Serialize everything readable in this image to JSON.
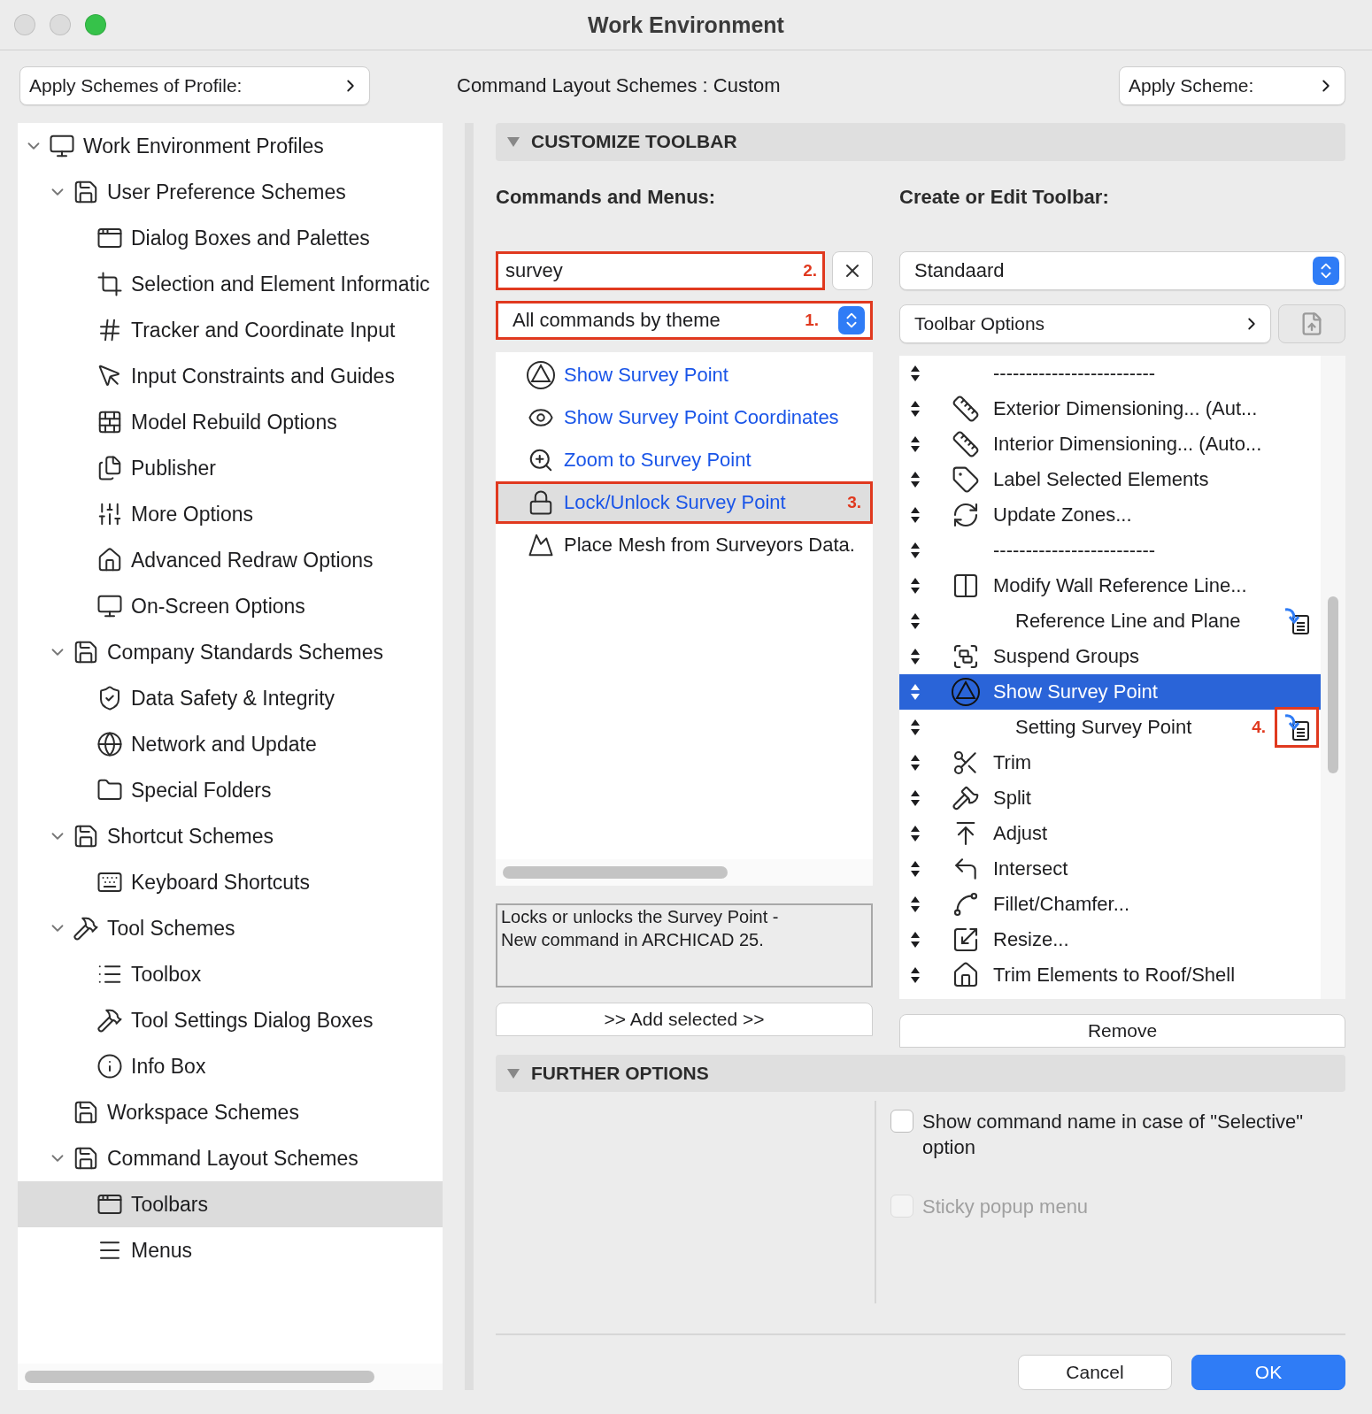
{
  "window": {
    "title": "Work Environment"
  },
  "top_bar": {
    "profile_button": "Apply Schemes of Profile:",
    "scheme_label": "Command Layout Schemes :",
    "scheme_value": "Custom",
    "apply_button": "Apply Scheme:"
  },
  "sidebar": {
    "items": [
      {
        "label": "Work Environment Profiles",
        "expanded": true,
        "selected": false,
        "children": [
          {
            "label": "User Preference Schemes",
            "expanded": true,
            "selected": false,
            "children": [
              {
                "label": "Dialog Boxes and Palettes",
                "selected": false
              },
              {
                "label": "Selection and Element Informatic",
                "selected": false
              },
              {
                "label": "Tracker and Coordinate Input",
                "selected": false
              },
              {
                "label": "Input Constraints and Guides",
                "selected": false
              },
              {
                "label": "Model Rebuild Options",
                "selected": false
              },
              {
                "label": "Publisher",
                "selected": false
              },
              {
                "label": "More Options",
                "selected": false
              },
              {
                "label": "Advanced Redraw Options",
                "selected": false
              },
              {
                "label": "On-Screen Options",
                "selected": false
              }
            ]
          },
          {
            "label": "Company Standards Schemes",
            "expanded": true,
            "selected": false,
            "children": [
              {
                "label": "Data Safety & Integrity",
                "selected": false
              },
              {
                "label": "Network and Update",
                "selected": false
              },
              {
                "label": "Special Folders",
                "selected": false
              }
            ]
          },
          {
            "label": "Shortcut Schemes",
            "expanded": true,
            "selected": false,
            "children": [
              {
                "label": "Keyboard Shortcuts",
                "selected": false
              }
            ]
          },
          {
            "label": "Tool Schemes",
            "expanded": true,
            "selected": false,
            "children": [
              {
                "label": "Toolbox",
                "selected": false
              },
              {
                "label": "Tool Settings Dialog Boxes",
                "selected": false
              },
              {
                "label": "Info Box",
                "selected": false
              }
            ]
          },
          {
            "label": "Workspace Schemes",
            "selected": false
          },
          {
            "label": "Command Layout Schemes",
            "expanded": true,
            "selected": false,
            "children": [
              {
                "label": "Toolbars",
                "selected": true
              },
              {
                "label": "Menus",
                "selected": false
              }
            ]
          }
        ]
      }
    ]
  },
  "customize": {
    "title": "CUSTOMIZE TOOLBAR",
    "expanded": true
  },
  "commands": {
    "heading": "Commands and Menus:",
    "search": {
      "value": "survey",
      "annotation": "2."
    },
    "filter": {
      "value": "All commands by theme",
      "annotation": "1."
    },
    "items": [
      {
        "label": "Show Survey Point",
        "highlighted": true,
        "selected": false
      },
      {
        "label": "Show Survey Point Coordinates",
        "highlighted": true,
        "selected": false
      },
      {
        "label": "Zoom to Survey Point",
        "highlighted": true,
        "selected": false
      },
      {
        "label": "Lock/Unlock Survey Point",
        "highlighted": true,
        "selected": true,
        "annotation": "3."
      },
      {
        "label": "Place Mesh from Surveyors Data.",
        "highlighted": false,
        "selected": false
      }
    ],
    "description": "Locks or unlocks the Survey Point -\nNew command in ARCHICAD 25.",
    "add_button": ">> Add selected >>"
  },
  "toolbar": {
    "heading": "Create or Edit Toolbar:",
    "select": "Standaard",
    "options_button": "Toolbar Options",
    "items": [
      {
        "kind": "separator",
        "label": "-------------------------",
        "selected": false
      },
      {
        "kind": "command",
        "label": "Exterior Dimensioning... (Aut...",
        "selected": false
      },
      {
        "kind": "command",
        "label": "Interior Dimensioning... (Auto...",
        "selected": false
      },
      {
        "kind": "command",
        "label": "Label Selected Elements",
        "selected": false
      },
      {
        "kind": "command",
        "label": "Update Zones...",
        "selected": false
      },
      {
        "kind": "separator",
        "label": "-------------------------",
        "selected": false
      },
      {
        "kind": "command",
        "label": "Modify Wall Reference Line...",
        "selected": false
      },
      {
        "kind": "sub",
        "label": "Reference Line and Plane",
        "selected": false
      },
      {
        "kind": "command",
        "label": "Suspend Groups",
        "selected": false
      },
      {
        "kind": "command",
        "label": "Show Survey Point",
        "selected": true
      },
      {
        "kind": "sub",
        "label": "Setting Survey Point",
        "selected": false,
        "annotation": "4."
      },
      {
        "kind": "command",
        "label": "Trim",
        "selected": false
      },
      {
        "kind": "command",
        "label": "Split",
        "selected": false
      },
      {
        "kind": "command",
        "label": "Adjust",
        "selected": false
      },
      {
        "kind": "command",
        "label": "Intersect",
        "selected": false
      },
      {
        "kind": "command",
        "label": "Fillet/Chamfer...",
        "selected": false
      },
      {
        "kind": "command",
        "label": "Resize...",
        "selected": false
      },
      {
        "kind": "command",
        "label": "Trim Elements to Roof/Shell",
        "selected": false
      }
    ],
    "remove_button": "Remove"
  },
  "further": {
    "title": "FURTHER OPTIONS",
    "expanded": true,
    "options": [
      {
        "label": "Show command name in case of \"Selective\" option",
        "checked": false,
        "disabled": false
      },
      {
        "label": "Sticky popup menu",
        "checked": false,
        "disabled": true
      }
    ]
  },
  "buttons": [
    {
      "label": "Cancel",
      "primary": false
    },
    {
      "label": "OK",
      "primary": true
    }
  ]
}
